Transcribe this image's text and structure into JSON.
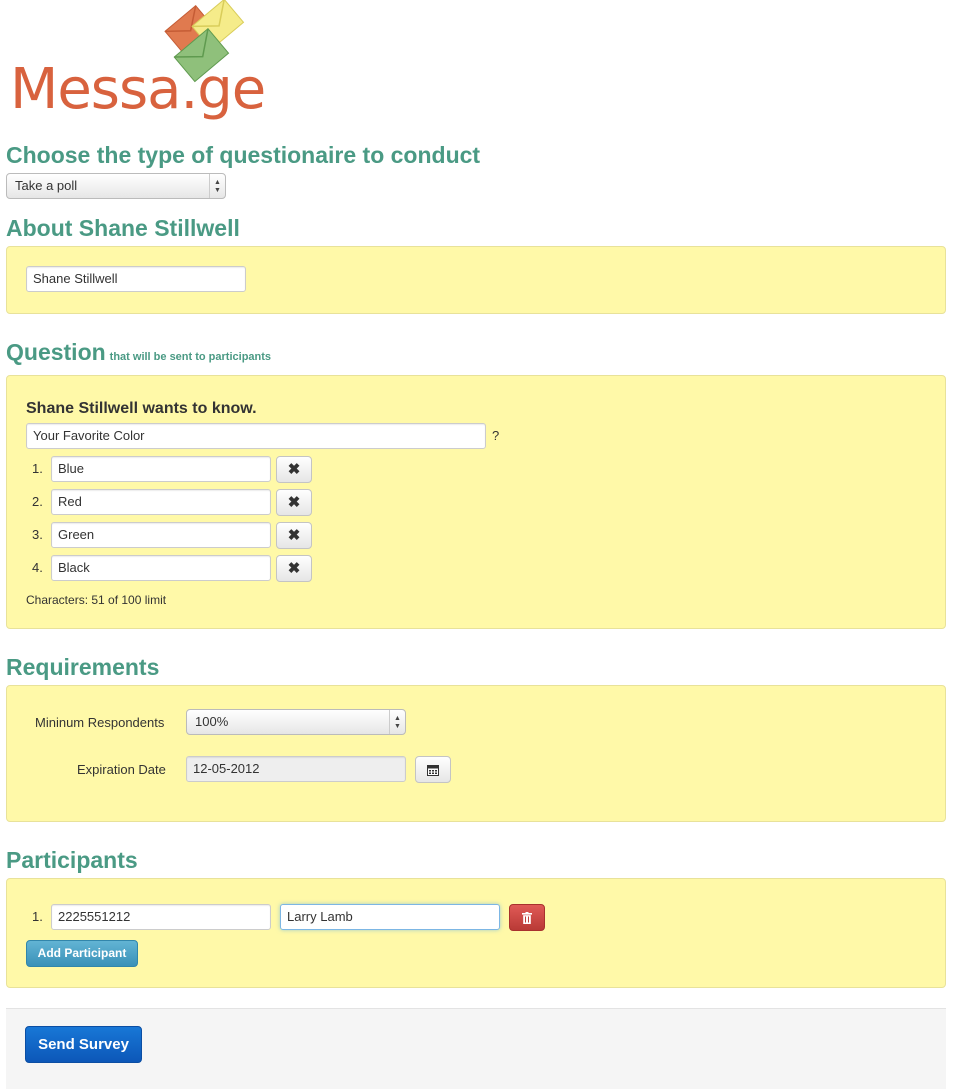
{
  "logo": {
    "text": "Messa.ge"
  },
  "poll_type": {
    "heading": "Choose the type of questionaire to conduct",
    "selected": "Take a poll"
  },
  "about": {
    "heading": "About Shane Stillwell",
    "name_value": "Shane Stillwell"
  },
  "question": {
    "heading": "Question",
    "subheading": "that will be sent to participants",
    "wants_to_know": "Shane Stillwell wants to know.",
    "question_value": "Your Favorite Color",
    "question_mark": "?",
    "options": [
      {
        "num": "1.",
        "value": "Blue"
      },
      {
        "num": "2.",
        "value": "Red"
      },
      {
        "num": "3.",
        "value": "Green"
      },
      {
        "num": "4.",
        "value": "Black"
      }
    ],
    "remove_glyph": "✖",
    "characters": "Characters: 51 of 100 limit"
  },
  "requirements": {
    "heading": "Requirements",
    "min_label": "Mininum Respondents",
    "min_value": "100%",
    "exp_label": "Expiration Date",
    "exp_value": "12-05-2012"
  },
  "participants": {
    "heading": "Participants",
    "rows": [
      {
        "num": "1.",
        "phone": "2225551212",
        "name": "Larry Lamb"
      }
    ],
    "add_label": "Add Participant"
  },
  "footer": {
    "send_label": "Send Survey"
  },
  "colors": {
    "heading": "#4a9a84",
    "panel": "#fff9a8",
    "logo": "#d8623e",
    "primary": "#0e5fc4",
    "danger": "#c9302c",
    "info": "#4aa3c4"
  },
  "icons": {
    "calendar": "calendar-icon",
    "trash": "trash-icon",
    "remove": "close-icon",
    "select_arrows": "select-arrows-icon"
  }
}
